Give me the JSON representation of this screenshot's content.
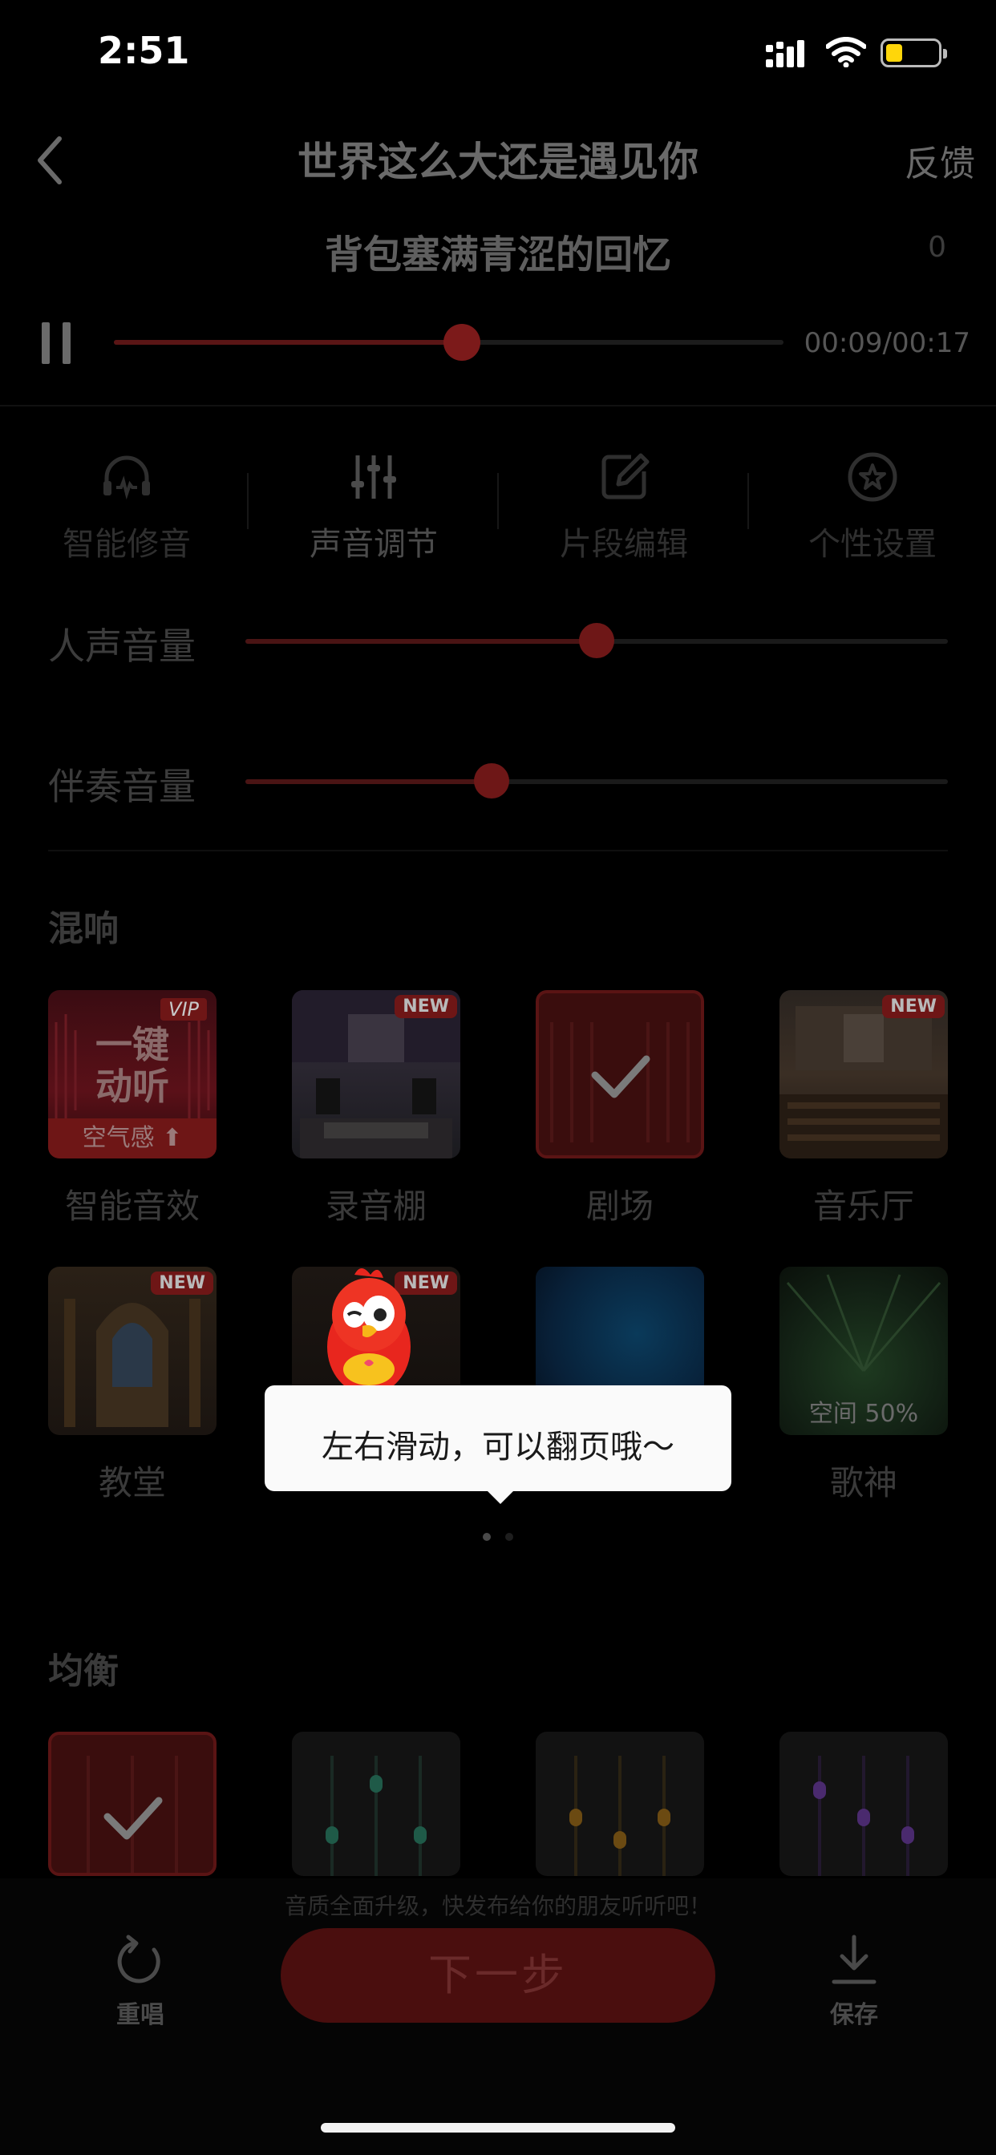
{
  "status_bar": {
    "time": "2:51"
  },
  "header": {
    "song_title": "世界这么大还是遇见你",
    "feedback_label": "反馈",
    "lyric_line": "背包塞满青涩的回忆",
    "lyric_count": "0"
  },
  "playback": {
    "time_readout": "00:09/00:17",
    "progress_fraction": 0.52
  },
  "tabs": [
    {
      "label": "智能修音",
      "icon": "headphones-waveform-icon"
    },
    {
      "label": "声音调节",
      "icon": "sliders-icon"
    },
    {
      "label": "片段编辑",
      "icon": "edit-icon"
    },
    {
      "label": "个性设置",
      "icon": "star-refresh-icon"
    }
  ],
  "active_tab": "声音调节",
  "volume": {
    "vocal_label": "人声音量",
    "vocal_level": 0.5,
    "accompaniment_label": "伴奏音量",
    "accompaniment_level": 0.35
  },
  "reverb": {
    "section_title": "混响",
    "items": [
      {
        "label": "智能音效",
        "badge": "VIP",
        "thumb_line1": "一键",
        "thumb_line2": "动听",
        "thumb_footer": "空气感 ⬆"
      },
      {
        "label": "录音棚",
        "badge": "NEW"
      },
      {
        "label": "剧场",
        "badge": "",
        "selected": true
      },
      {
        "label": "音乐厅",
        "badge": "NEW"
      },
      {
        "label": "教堂",
        "badge": "NEW"
      },
      {
        "label": "",
        "badge": "NEW"
      },
      {
        "label": "",
        "badge": ""
      },
      {
        "label": "歌神",
        "badge": "",
        "thumb_footer": "空间 50%"
      }
    ],
    "page_count": 2,
    "current_page": 1
  },
  "equalizer": {
    "section_title": "均衡",
    "tile_colors": [
      "#6e1616",
      "#1f5a48",
      "#6b4a12",
      "#4a2a6e"
    ]
  },
  "tooltip": {
    "text": "左右滑动，可以翻页哦～"
  },
  "bottom": {
    "hint": "音质全面升级，快发布给你的朋友听听吧！",
    "redo_label": "重唱",
    "next_label": "下一步",
    "save_label": "保存"
  },
  "colors": {
    "accent": "#7c1a1a",
    "background": "#000000"
  }
}
